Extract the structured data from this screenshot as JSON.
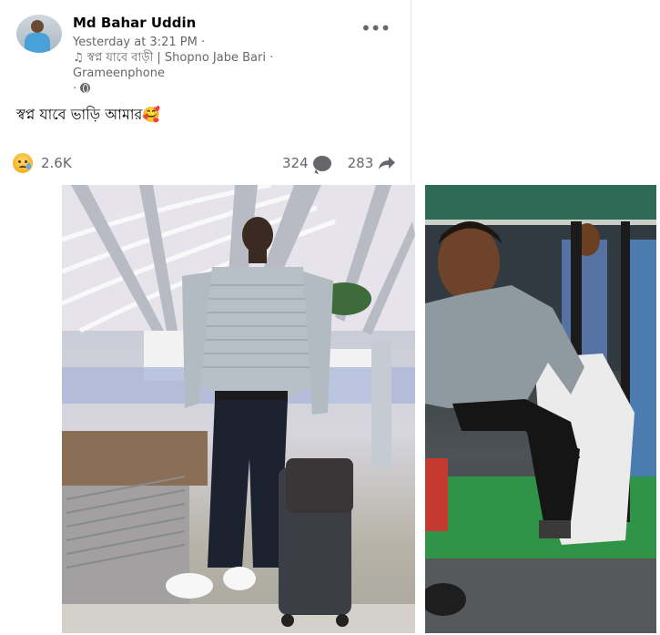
{
  "post": {
    "author": "Md Bahar Uddin",
    "timestamp": "Yesterday at 3:21 PM",
    "meta_separator": "·",
    "song_icon": "music-note-icon",
    "song_line": "স্বপ্ন যাবে বাড়ী | Shopno Jabe Bari ·",
    "song_line2": "Grameenphone",
    "privacy_sep": "·",
    "privacy_icon": "globe-icon",
    "more_label": "•••",
    "text": "স্বপ্ন যাবে ভাড়ি আমার🥰",
    "reaction_icon": "sad-emoji-icon",
    "reaction_count": "2.6K",
    "comment_count": "324",
    "comment_icon": "comment-icon",
    "share_count": "283",
    "share_icon": "share-icon"
  },
  "photos": [
    {
      "name": "airport-photo"
    },
    {
      "name": "cng-rickshaw-photo"
    }
  ],
  "colors": {
    "primary_text": "#050505",
    "secondary_text": "#65676b",
    "reaction_yellow": "#f7b125"
  }
}
